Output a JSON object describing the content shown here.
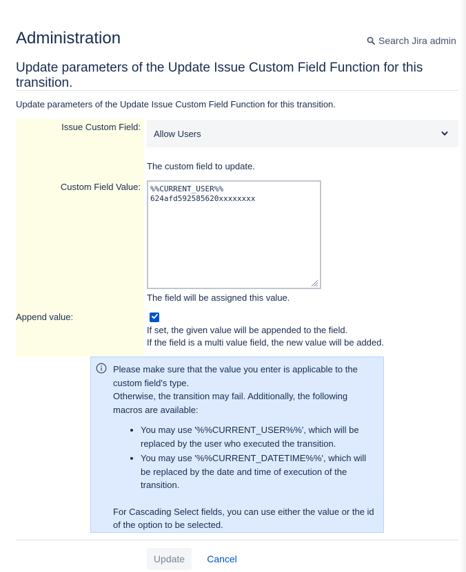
{
  "header": {
    "title": "Administration",
    "search_label": "Search Jira admin"
  },
  "page": {
    "heading": "Update parameters of the Update Issue Custom Field Function for this transition.",
    "description": "Update parameters of the Update Issue Custom Field Function for this transition."
  },
  "form": {
    "custom_field": {
      "label": "Issue Custom Field:",
      "selected_value": "Allow Users",
      "help": "The custom field to update."
    },
    "field_value": {
      "label": "Custom Field Value:",
      "value": "%%CURRENT_USER%%\n624afd592585620xxxxxxxx",
      "help": "The field will be assigned this value."
    },
    "append_value": {
      "label": "Append value:",
      "checked": true,
      "help_line1": "If set, the given value will be appended to the field.",
      "help_line2": "If the field is a multi value field, the new value will be added."
    }
  },
  "info": {
    "intro_line1": "Please make sure that the value you enter is applicable to the custom field's type.",
    "intro_line2": "Otherwise, the transition may fail. Additionally, the following macros are available:",
    "bullets": [
      "You may use '%%CURRENT_USER%%', which will be replaced by the user who executed the transition.",
      "You may use '%%CURRENT_DATETIME%%', which will be replaced by the date and time of execution of the transition."
    ],
    "footer": "For Cascading Select fields, you can use either the value or the id of the option to be selected."
  },
  "actions": {
    "update_label": "Update",
    "cancel_label": "Cancel"
  },
  "colors": {
    "primary": "#0052cc",
    "label_column_bg": "#fefee6",
    "info_bg": "#deebff"
  },
  "icons": {
    "search": "search-icon",
    "dropdown": "chevron-down-icon",
    "info": "info-icon",
    "check": "check-icon"
  }
}
